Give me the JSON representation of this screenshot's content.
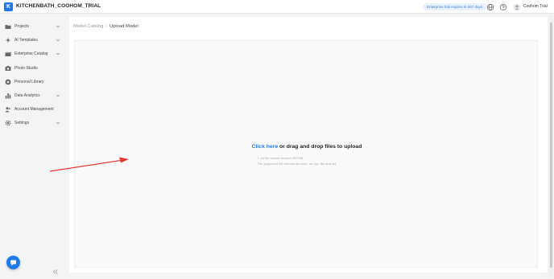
{
  "header": {
    "logo_letter": "K",
    "org_name": "KITCHENBATH_COOHOM_TRIAL",
    "trial_badge": "Enterprise trial expires in 567 days",
    "user_name": "Coohom Trial",
    "icons": [
      "globe-icon",
      "help-icon",
      "user-avatar-icon"
    ]
  },
  "sidebar": {
    "items": [
      {
        "label": "Projects",
        "icon": "folder-icon",
        "expandable": true
      },
      {
        "label": "AI Templates",
        "icon": "sparkle-icon",
        "expandable": true
      },
      {
        "label": "Enterprise Catalog",
        "icon": "catalog-icon",
        "expandable": true
      },
      {
        "label": "Photo Studio",
        "icon": "camera-icon",
        "expandable": false
      },
      {
        "label": "Personal Library",
        "icon": "library-icon",
        "expandable": false
      },
      {
        "label": "Data Analytics",
        "icon": "bar-chart-icon",
        "expandable": true
      },
      {
        "label": "Account Management",
        "icon": "people-icon",
        "expandable": false
      },
      {
        "label": "Settings",
        "icon": "gear-icon",
        "expandable": true
      }
    ]
  },
  "breadcrumb": {
    "parent": "Model Catalog",
    "separator": "/",
    "current": "Upload Model"
  },
  "upload": {
    "link_text": "Click here",
    "rest_text": " or drag and drop files to upload",
    "hints": [
      "· 1 cm file cannot exceed 300 MB",
      "· The supported file formats are max, rar, zip, fbx and obj"
    ]
  },
  "colors": {
    "accent": "#1f7ae8",
    "annotation_arrow": "#e53935"
  }
}
